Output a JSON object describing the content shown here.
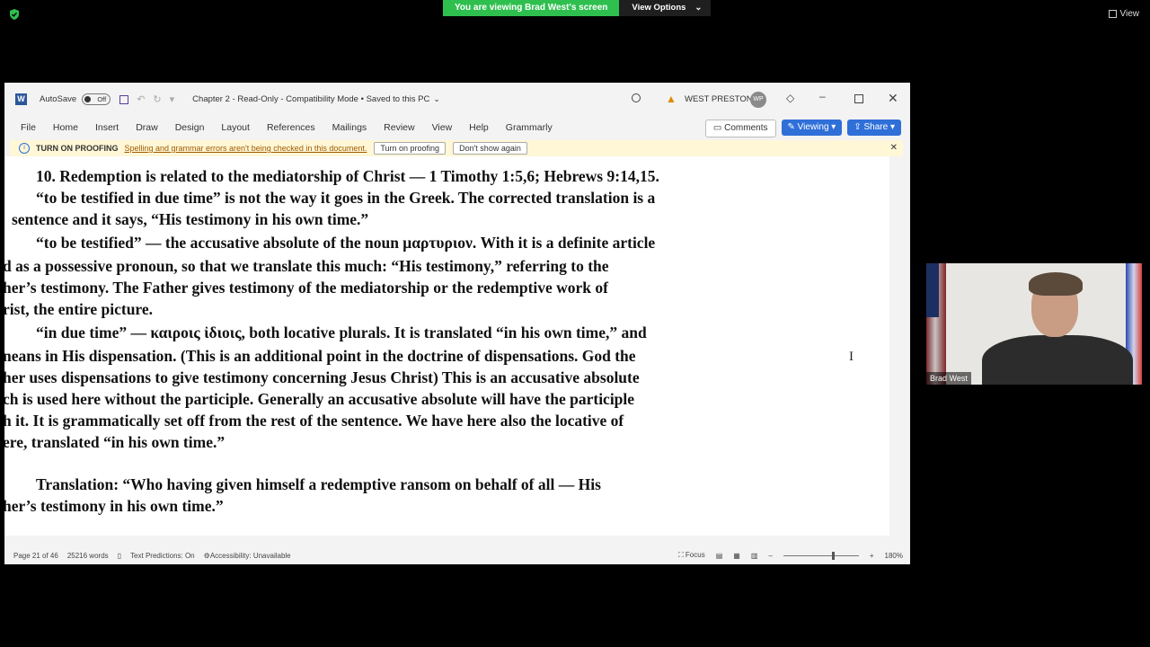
{
  "zoom_bar": {
    "sharing_text": "You are viewing Brad West's screen",
    "view_options_label": "View Options",
    "view_label": "View"
  },
  "word": {
    "title_bar": {
      "autosave_label": "AutoSave",
      "autosave_state": "Off",
      "document_title": "Chapter 2  -  Read-Only  -  Compatibility Mode  •  Saved to this PC",
      "user_name": "WEST PRESTON",
      "user_initials": "WP"
    },
    "ribbon_tabs": [
      "File",
      "Home",
      "Insert",
      "Draw",
      "Design",
      "Layout",
      "References",
      "Mailings",
      "Review",
      "View",
      "Help",
      "Grammarly"
    ],
    "ribbon_buttons": {
      "comments": "Comments",
      "viewing": "Viewing",
      "share": "Share"
    },
    "message_bar": {
      "title": "TURN ON PROOFING",
      "text": "Spelling and grammar errors aren't being checked in this document.",
      "button_turn_on": "Turn on proofing",
      "button_dismiss": "Don't show again"
    },
    "document_lines": [
      "10. Redemption is related to the mediatorship of Christ — 1 Timothy 1:5,6; Hebrews 9:14,15.",
      "“to be testified in due time” is not the way it goes in the Greek. The corrected translation is a",
      "sentence and it says, “His testimony in his own time.”",
      "“to be testified” — the accusative absolute of the noun μαρτυριον. With it is a definite article",
      "d as a possessive pronoun, so that we translate this much: “His testimony,” referring to the",
      "her’s testimony. The Father gives testimony of the mediatorship or the redemptive work of",
      "rist, the entire picture.",
      "“in due time” — καιροις ἰδιοις, both locative plurals. It is translated “in his own time,” and",
      "neans in His dispensation. (This is an additional point in the doctrine of dispensations. God the",
      "her uses dispensations to give testimony concerning Jesus Christ) This is an accusative absolute",
      "ch is used here without the participle. Generally an accusative absolute will have the participle",
      "h it. It is grammatically set off from the rest of the sentence. We have here also the locative of",
      "ere, translated “in his own time.”",
      "Translation: “Who having given himself a redemptive ransom on behalf of all — His",
      "her’s testimony in his own time.”"
    ],
    "status_bar": {
      "page": "Page 21 of 46",
      "words": "25216 words",
      "text_predictions": "Text Predictions: On",
      "accessibility": "Accessibility: Unavailable",
      "focus": "Focus",
      "zoom_percent": "180%",
      "zoom_slider_fraction": 0.66
    }
  },
  "participant": {
    "name": "Brad West"
  }
}
